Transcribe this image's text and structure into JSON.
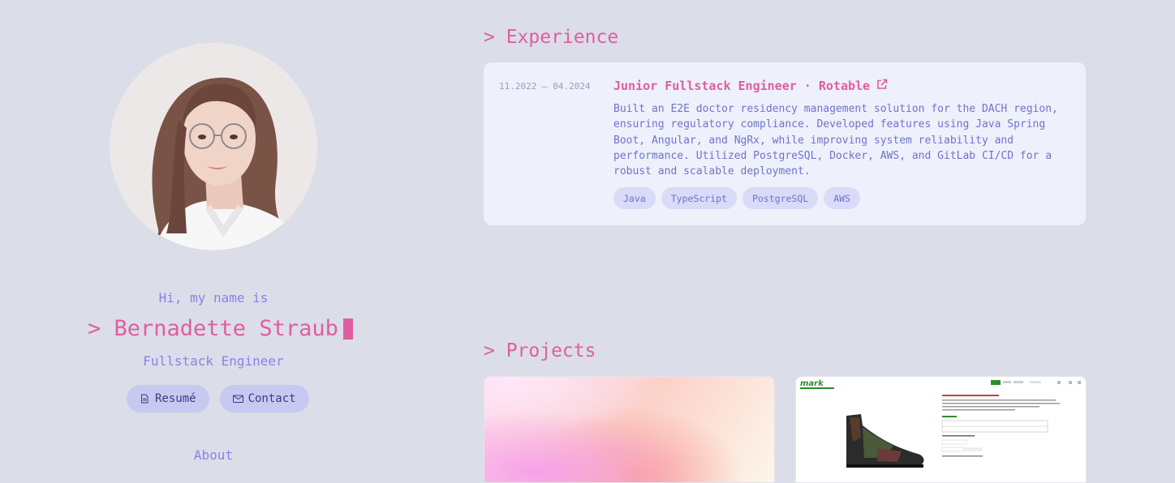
{
  "profile": {
    "greeting": "Hi, my name is",
    "name": "> Bernadette Straub",
    "role": "Fullstack Engineer",
    "buttons": [
      {
        "label": "Resumé",
        "icon": "document-icon"
      },
      {
        "label": "Contact",
        "icon": "envelope-icon"
      }
    ],
    "nav_about": "About"
  },
  "experience": {
    "heading": "> Experience",
    "items": [
      {
        "dates": "11.2022 — 04.2024",
        "title": "Junior Fullstack Engineer · Rotable",
        "description": "Built an E2E doctor residency management solution for the DACH region, ensuring regulatory compliance. Developed features using Java Spring Boot, Angular, and NgRx, while improving system reliability and performance. Utilized PostgreSQL, Docker, AWS, and GitLab CI/CD for a robust and scalable deployment.",
        "tags": [
          "Java",
          "TypeScript",
          "PostgreSQL",
          "AWS"
        ]
      }
    ]
  },
  "projects": {
    "heading": "> Projects",
    "cards": [
      {
        "thumbnail": "gradient-thumbnail"
      },
      {
        "thumbnail": "shoe-shop-thumbnail",
        "logo_text": "mark"
      }
    ]
  },
  "colors": {
    "background": "#dbdde9",
    "accent_pink": "#df5ea0",
    "accent_purple": "#8a83e6",
    "card_bg": "#eef0fc"
  }
}
